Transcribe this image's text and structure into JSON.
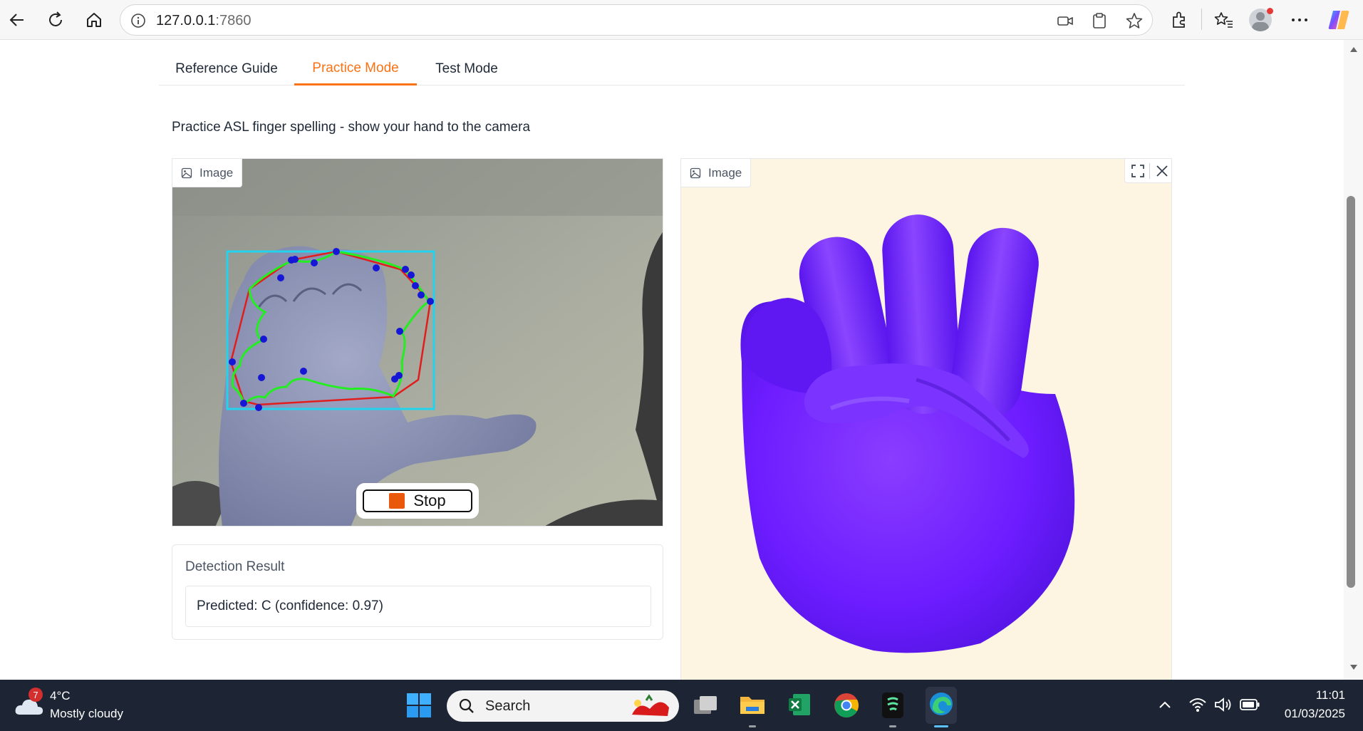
{
  "browser": {
    "url_host": "127.0.0.1",
    "url_port": ":7860"
  },
  "tabs": [
    {
      "label": "Reference Guide"
    },
    {
      "label": "Practice Mode"
    },
    {
      "label": "Test Mode"
    }
  ],
  "description": "Practice ASL finger spelling - show your hand to the camera",
  "webcam_panel": {
    "label": "Image",
    "stop_label": "Stop"
  },
  "model_panel": {
    "label": "Image"
  },
  "detection": {
    "label": "Detection Result",
    "value": "Predicted: C (confidence: 0.97)"
  },
  "taskbar": {
    "weather_temp": "4°C",
    "weather_desc": "Mostly cloudy",
    "weather_badge": "7",
    "search_placeholder": "Search",
    "time": "11:01",
    "date": "01/03/2025"
  },
  "colors": {
    "accent": "#f97316",
    "stop_square": "#ea580c",
    "hand_model": "#6c1cff",
    "model_bg": "#fdf5e2",
    "bbox": "#22d3ee",
    "hull": "#e11d1d",
    "contour": "#22ee22",
    "keypoints": "#1616d6"
  }
}
